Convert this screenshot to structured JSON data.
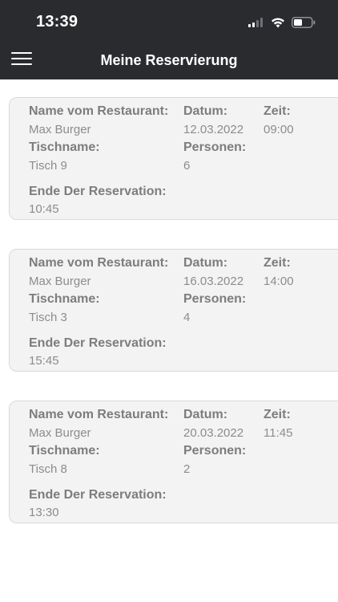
{
  "status_bar": {
    "time": "13:39",
    "icons": [
      "cellular-signal-icon",
      "wifi-icon",
      "battery-icon"
    ]
  },
  "header": {
    "title": "Meine Reservierung",
    "menu_icon": "hamburger-menu-icon"
  },
  "labels": {
    "restaurant": "Name vom Restaurant:",
    "date": "Datum:",
    "time": "Zeit:",
    "table": "Tischname:",
    "persons": "Personen:",
    "end": "Ende Der Reservation:"
  },
  "reservations": [
    {
      "restaurant": "Max Burger",
      "date": "12.03.2022",
      "time": "09:00",
      "table": "Tisch 9",
      "persons": "6",
      "end": "10:45"
    },
    {
      "restaurant": "Max Burger",
      "date": "16.03.2022",
      "time": "14:00",
      "table": "Tisch 3",
      "persons": "4",
      "end": "15:45"
    },
    {
      "restaurant": "Max Burger",
      "date": "20.03.2022",
      "time": "11:45",
      "table": "Tisch 8",
      "persons": "2",
      "end": "13:30"
    }
  ],
  "colors": {
    "bar_background": "#2a2b2f",
    "card_background": "#f4f3f4",
    "card_border": "#d9d9d9",
    "label_text": "#7d7d7d",
    "value_text": "#8c8c8c"
  }
}
